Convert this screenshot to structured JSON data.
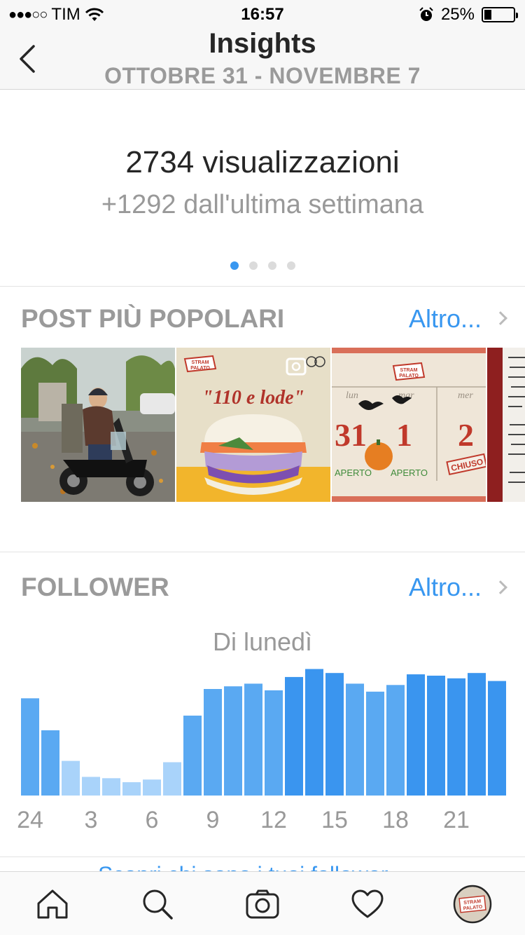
{
  "status_bar": {
    "signal": "●●●○○",
    "carrier": "TIM",
    "time": "16:57",
    "battery_percent_label": "25%",
    "battery_level": 0.25
  },
  "header": {
    "title": "Insights",
    "date_range": "OTTOBRE 31 - NOVEMBRE 7"
  },
  "summary": {
    "views": "2734 visualizzazioni",
    "change": "+1292 dall'ultima settimana",
    "page_count": 4,
    "active_page": 0
  },
  "popular_posts": {
    "title": "POST PIÙ POPOLARI",
    "more": "Altro...",
    "posts": [
      {
        "type": "photo",
        "subject": "scooter-delivery"
      },
      {
        "type": "video",
        "subject": "burger",
        "caption": "\"110 e lode\""
      },
      {
        "type": "photo",
        "subject": "calendar",
        "days": [
          {
            "weekday": "lun",
            "number": "31",
            "status": "APERTO"
          },
          {
            "weekday": "mar",
            "number": "1",
            "status": "APERTO"
          },
          {
            "weekday": "mer",
            "number": "2",
            "status": "CHIUSO"
          }
        ]
      },
      {
        "type": "photo",
        "subject": "handwritten-note"
      }
    ]
  },
  "followers": {
    "title": "FOLLOWER",
    "more": "Altro...",
    "chart_label": "Di lunedì"
  },
  "chart_data": {
    "type": "bar",
    "title": "Di lunedì",
    "tick_labels": [
      "24",
      "3",
      "6",
      "9",
      "12",
      "15",
      "18",
      "21"
    ],
    "categories": [
      0,
      1,
      2,
      3,
      4,
      5,
      6,
      7,
      8,
      9,
      10,
      11,
      12,
      13,
      14,
      15,
      16,
      17,
      18,
      19,
      20,
      21,
      22,
      23
    ],
    "values": [
      73,
      49,
      26,
      14,
      13,
      10,
      12,
      25,
      60,
      80,
      82,
      84,
      79,
      89,
      95,
      92,
      84,
      78,
      83,
      91,
      90,
      88,
      92,
      86
    ],
    "ylim": [
      0,
      100
    ],
    "colors": {
      "high": "#3a95ef",
      "mid": "#5aa9f2",
      "low": "#a9d3fa"
    }
  },
  "peek_text": "Scopri chi sono i tuoi follower",
  "tabbar": {
    "items": [
      "home-icon",
      "search-icon",
      "camera-icon",
      "heart-icon",
      "profile-avatar"
    ],
    "avatar_text": [
      "STRAM",
      "PALATO"
    ]
  },
  "colors": {
    "accent": "#3897f0",
    "header_bg": "#f7f7f7",
    "muted": "#9a9a9a"
  }
}
